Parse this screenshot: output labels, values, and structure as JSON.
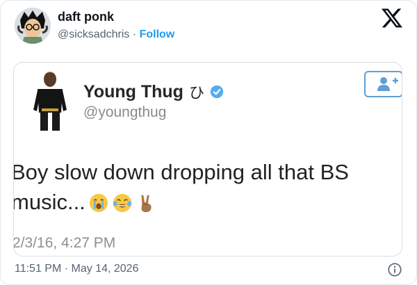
{
  "tweet": {
    "author": {
      "name": "daft ponk",
      "handle": "@sicksadchris",
      "separator": " · ",
      "follow_label": "Follow"
    },
    "timestamp": "11:51 PM · May 14, 2026"
  },
  "screenshot": {
    "name": "Young Thug",
    "name_symbol": "ひ",
    "handle": "@youngthug",
    "text_line1": "Boy slow down dropping all that BS",
    "text_line2": "music...",
    "emojis": [
      "crying-face",
      "tears-of-joy-face",
      "victory-hand"
    ],
    "time": "2/3/16, 4:27 PM"
  },
  "colors": {
    "accent": "#1d9bf0",
    "verified": "#55acee",
    "muted": "#536471"
  },
  "icons": [
    "x-logo-icon",
    "add-user-icon",
    "verified-badge-icon",
    "info-icon"
  ]
}
